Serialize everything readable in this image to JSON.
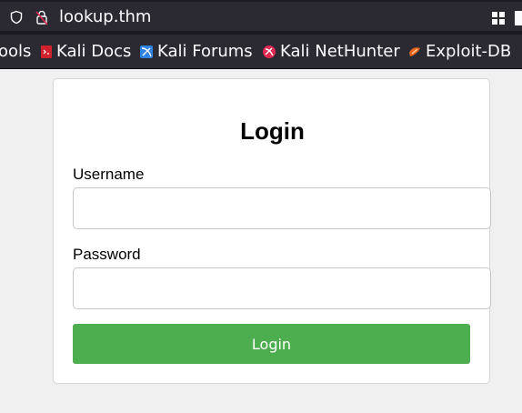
{
  "browser": {
    "url": "lookup.thm",
    "icons": {
      "tracking": "shield-icon",
      "security": "lock-strikethrough-icon",
      "extensions": "grid-icon"
    }
  },
  "bookmarks": {
    "items": [
      {
        "label": "ools",
        "icon": "partial"
      },
      {
        "label": "Kali Docs",
        "icon": "kali-docs-icon"
      },
      {
        "label": "Kali Forums",
        "icon": "kali-forums-icon"
      },
      {
        "label": "Kali NetHunter",
        "icon": "kali-nethunter-icon"
      },
      {
        "label": "Exploit-DB",
        "icon": "exploit-db-icon"
      }
    ]
  },
  "login": {
    "title": "Login",
    "username_label": "Username",
    "username_value": "",
    "password_label": "Password",
    "password_value": "",
    "button_label": "Login",
    "button_color": "#4cae4f"
  }
}
